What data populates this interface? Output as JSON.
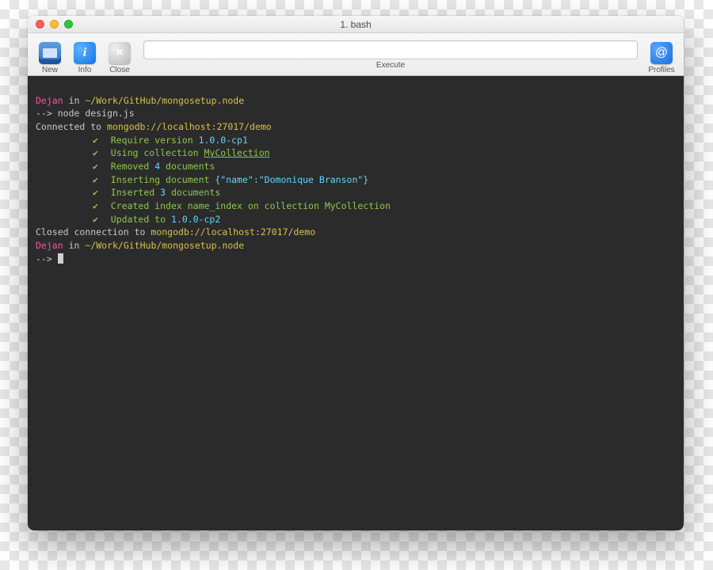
{
  "window": {
    "title": "1. bash"
  },
  "toolbar": {
    "new_label": "New",
    "info_label": "Info",
    "info_glyph": "i",
    "close_label": "Close",
    "close_glyph": "×",
    "execute_label": "Execute",
    "execute_value": "",
    "profiles_label": "Profiles",
    "profiles_glyph": "@"
  },
  "term": {
    "user": "Dejan",
    "in_word": "in",
    "path": "~/Work/GitHub/mongosetup.node",
    "prompt": "-->",
    "cmd1": "node design.js",
    "connected_prefix": "Connected to ",
    "conn_url": "mongodb://localhost:27017/demo",
    "check": "✔",
    "l_require_pre": "Require version ",
    "version1": "1.0.0-cp1",
    "l_using_pre": "Using collection ",
    "collection": "MyCollection",
    "l_removed_pre": "Removed ",
    "removed_n": "4",
    "l_removed_post": " documents",
    "l_insertdoc_pre": "Inserting document ",
    "insert_json": "{\"name\":\"Domonique Branson\"}",
    "l_inserted_pre": "Inserted ",
    "inserted_n": "3",
    "l_inserted_post": " documents",
    "l_index": "Created index name_index on collection MyCollection",
    "l_updated_pre": "Updated to ",
    "version2": "1.0.0-cp2",
    "closed_prefix": "Closed connection to ",
    "closed_url": "mongodb://localhost:27017/demo"
  }
}
